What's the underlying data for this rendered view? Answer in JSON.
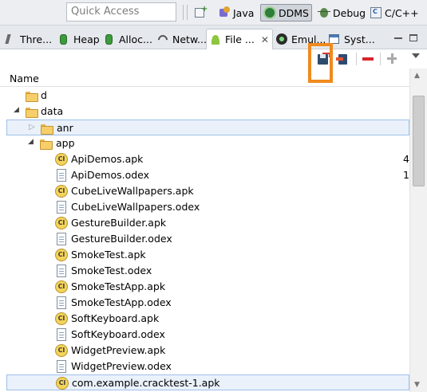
{
  "toolbar": {
    "quick_access_placeholder": "Quick Access",
    "perspectives": [
      {
        "label": "Java"
      },
      {
        "label": "DDMS"
      },
      {
        "label": "Debug"
      },
      {
        "label": "C/C++"
      }
    ]
  },
  "tabs": [
    {
      "label": "Thre..."
    },
    {
      "label": "Heap"
    },
    {
      "label": "Alloc..."
    },
    {
      "label": "Netw..."
    },
    {
      "label": "File ..."
    },
    {
      "label": "Emul..."
    },
    {
      "label": "Syst..."
    }
  ],
  "file_explorer": {
    "column_name": "Name",
    "rows": [
      {
        "name": "d",
        "type": "folder",
        "size": ""
      },
      {
        "name": "data",
        "type": "folder",
        "size": ""
      },
      {
        "name": "anr",
        "type": "folder",
        "size": ""
      },
      {
        "name": "app",
        "type": "folder",
        "size": ""
      },
      {
        "name": "ApiDemos.apk",
        "type": "apk",
        "size": "4"
      },
      {
        "name": "ApiDemos.odex",
        "type": "doc",
        "size": "1"
      },
      {
        "name": "CubeLiveWallpapers.apk",
        "type": "apk",
        "size": ""
      },
      {
        "name": "CubeLiveWallpapers.odex",
        "type": "doc",
        "size": ""
      },
      {
        "name": "GestureBuilder.apk",
        "type": "apk",
        "size": ""
      },
      {
        "name": "GestureBuilder.odex",
        "type": "doc",
        "size": ""
      },
      {
        "name": "SmokeTest.apk",
        "type": "apk",
        "size": ""
      },
      {
        "name": "SmokeTest.odex",
        "type": "doc",
        "size": ""
      },
      {
        "name": "SmokeTestApp.apk",
        "type": "apk",
        "size": ""
      },
      {
        "name": "SmokeTestApp.odex",
        "type": "doc",
        "size": ""
      },
      {
        "name": "SoftKeyboard.apk",
        "type": "apk",
        "size": ""
      },
      {
        "name": "SoftKeyboard.odex",
        "type": "doc",
        "size": ""
      },
      {
        "name": "WidgetPreview.apk",
        "type": "apk",
        "size": ""
      },
      {
        "name": "WidgetPreview.odex",
        "type": "doc",
        "size": ""
      },
      {
        "name": "com.example.cracktest-1.apk",
        "type": "apk",
        "size": ""
      }
    ]
  },
  "icons": {
    "apk_glyph": "CI"
  },
  "colors": {
    "highlight": "#f08a1e",
    "selection_border": "#9ec0e8",
    "selection_fill": "#eaf1fb",
    "delete_red": "#d6262b"
  }
}
